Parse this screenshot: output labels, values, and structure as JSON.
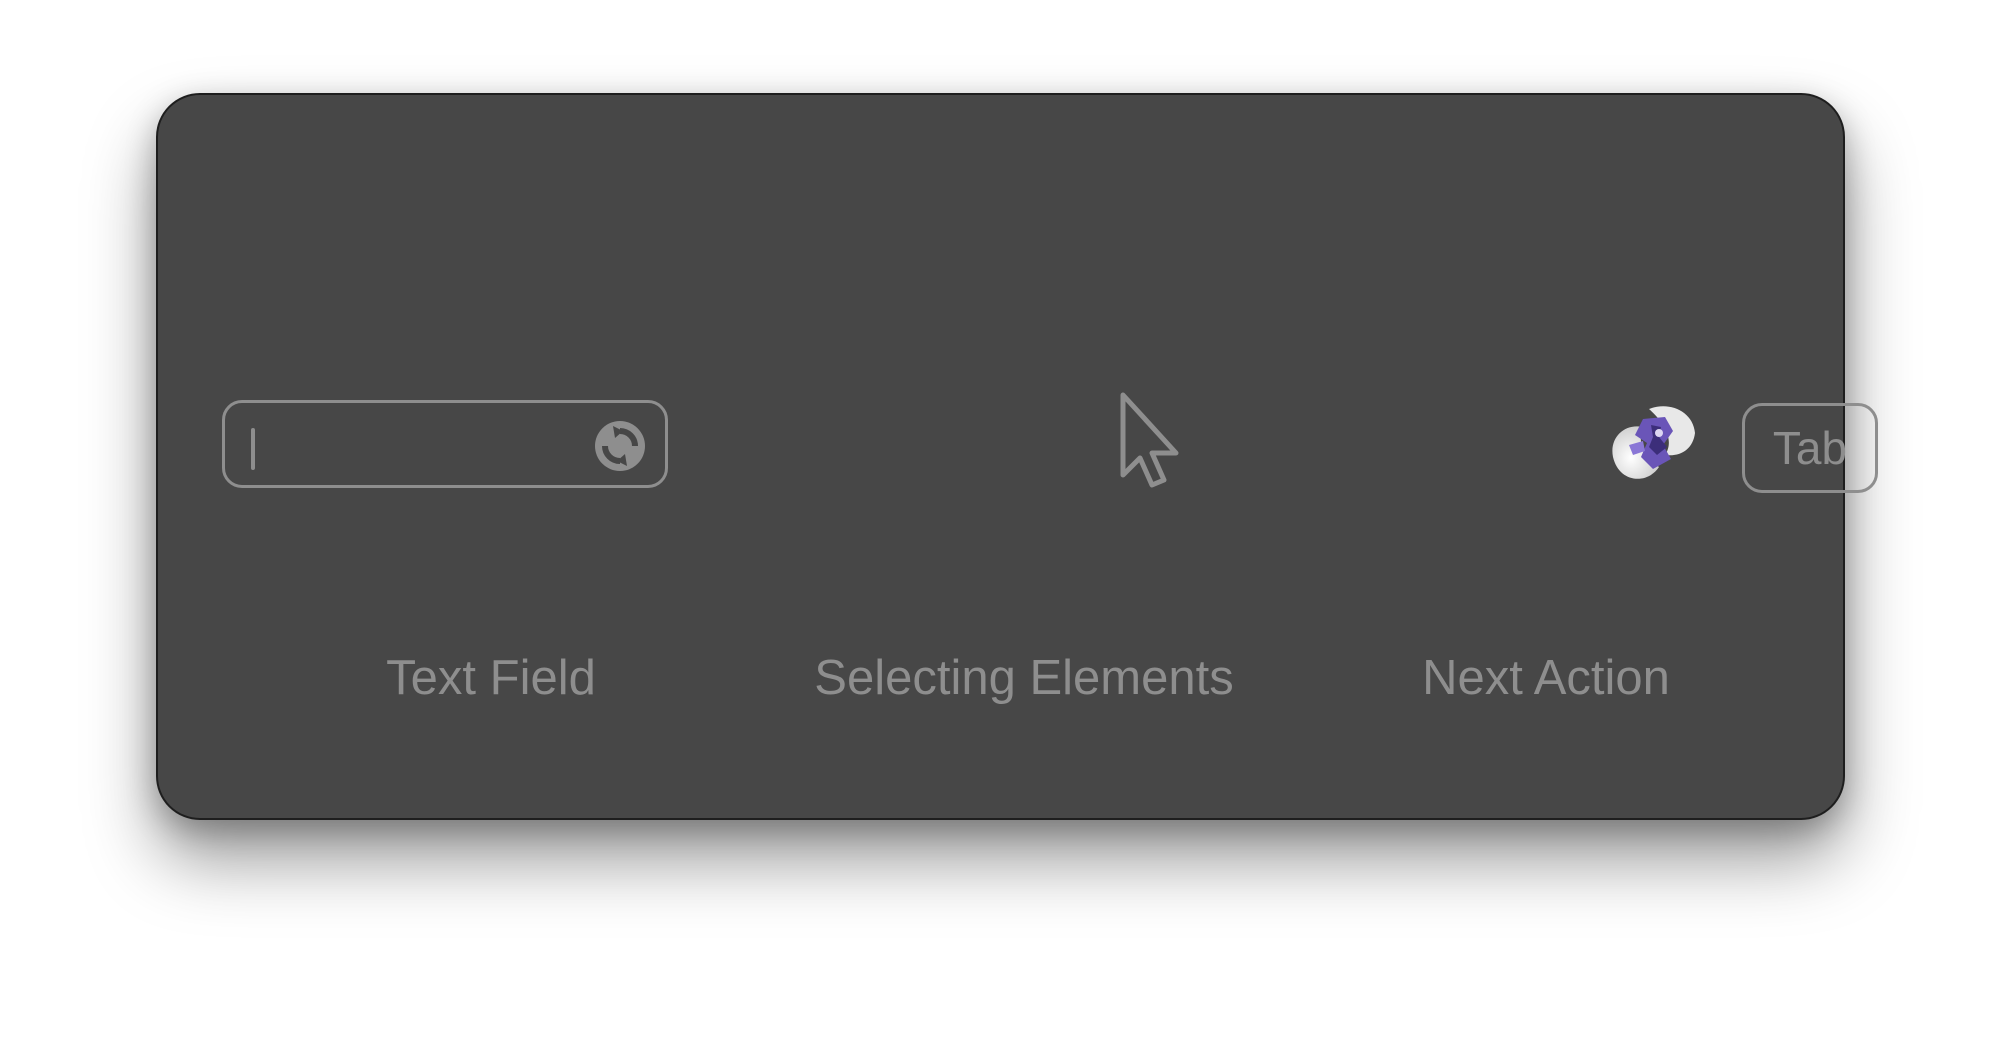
{
  "tutorial": {
    "text_field": {
      "label": "Text Field",
      "value": "",
      "icon": "sync-icon"
    },
    "selecting_elements": {
      "label": "Selecting Elements",
      "icon": "cursor-arrow-icon"
    },
    "next_action": {
      "label": "Next Action",
      "key": "Tab",
      "icon": "app-avatar"
    }
  },
  "colors": {
    "panel_bg": "#474747",
    "foreground": "#8e8e8e",
    "page_bg": "#ffffff"
  }
}
